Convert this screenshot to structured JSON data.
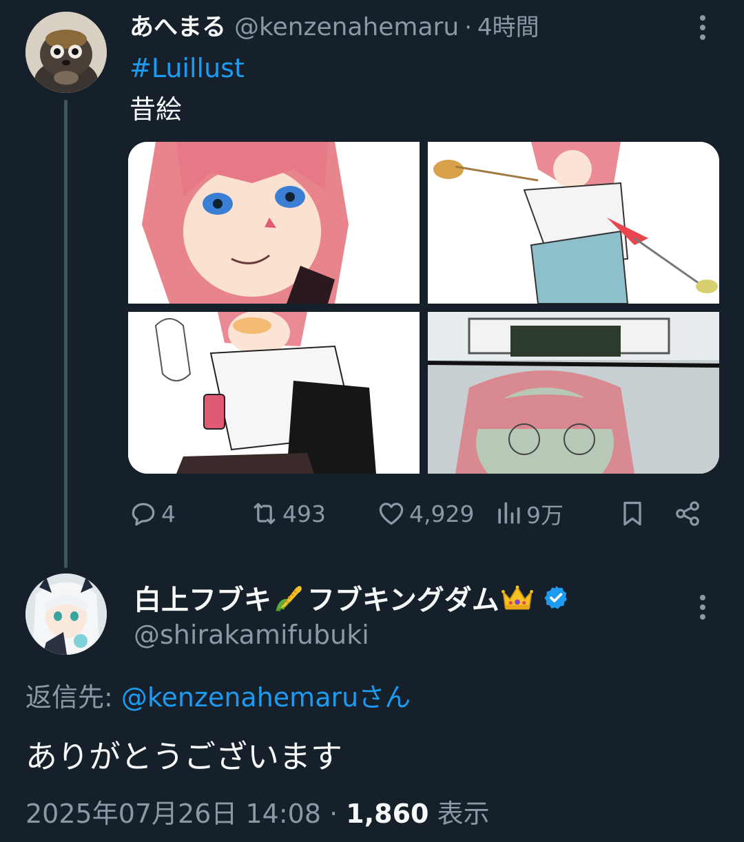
{
  "parent_tweet": {
    "avatar_icon": "tanuki-figurine-avatar",
    "display_name": "あへまる",
    "handle": "@kenzenahemaru",
    "separator": "·",
    "time": "4時間",
    "hashtag": "#Luillust",
    "text": "昔絵",
    "media": [
      {
        "icon": "illustration-girl-portrait"
      },
      {
        "icon": "illustration-girl-cooking"
      },
      {
        "icon": "illustration-girl-phone"
      },
      {
        "icon": "illustration-girl-glasses"
      }
    ],
    "actions": {
      "reply_count": "4",
      "retweet_count": "493",
      "like_count": "4,929",
      "view_count": "9万"
    }
  },
  "reply_tweet": {
    "avatar_icon": "anime-girl-avatar",
    "display_name_part1": "白上フブキ",
    "display_name_emoji1": "🌽",
    "display_name_part2": "フブキングダム",
    "display_name_emoji2": "👑",
    "handle": "@shirakamifubuki",
    "reply_to_label": "返信先:",
    "reply_to_handle": "@kenzenahemaruさん",
    "text": "ありがとうございます",
    "timestamp": "2025年07月26日 14:08",
    "meta_separator": "·",
    "views_count": "1,860",
    "views_label": "表示"
  },
  "colors": {
    "background": "#15202b",
    "accent": "#1d9bf0",
    "secondary_text": "#8b98a5",
    "primary_text": "#f7f9f9"
  }
}
